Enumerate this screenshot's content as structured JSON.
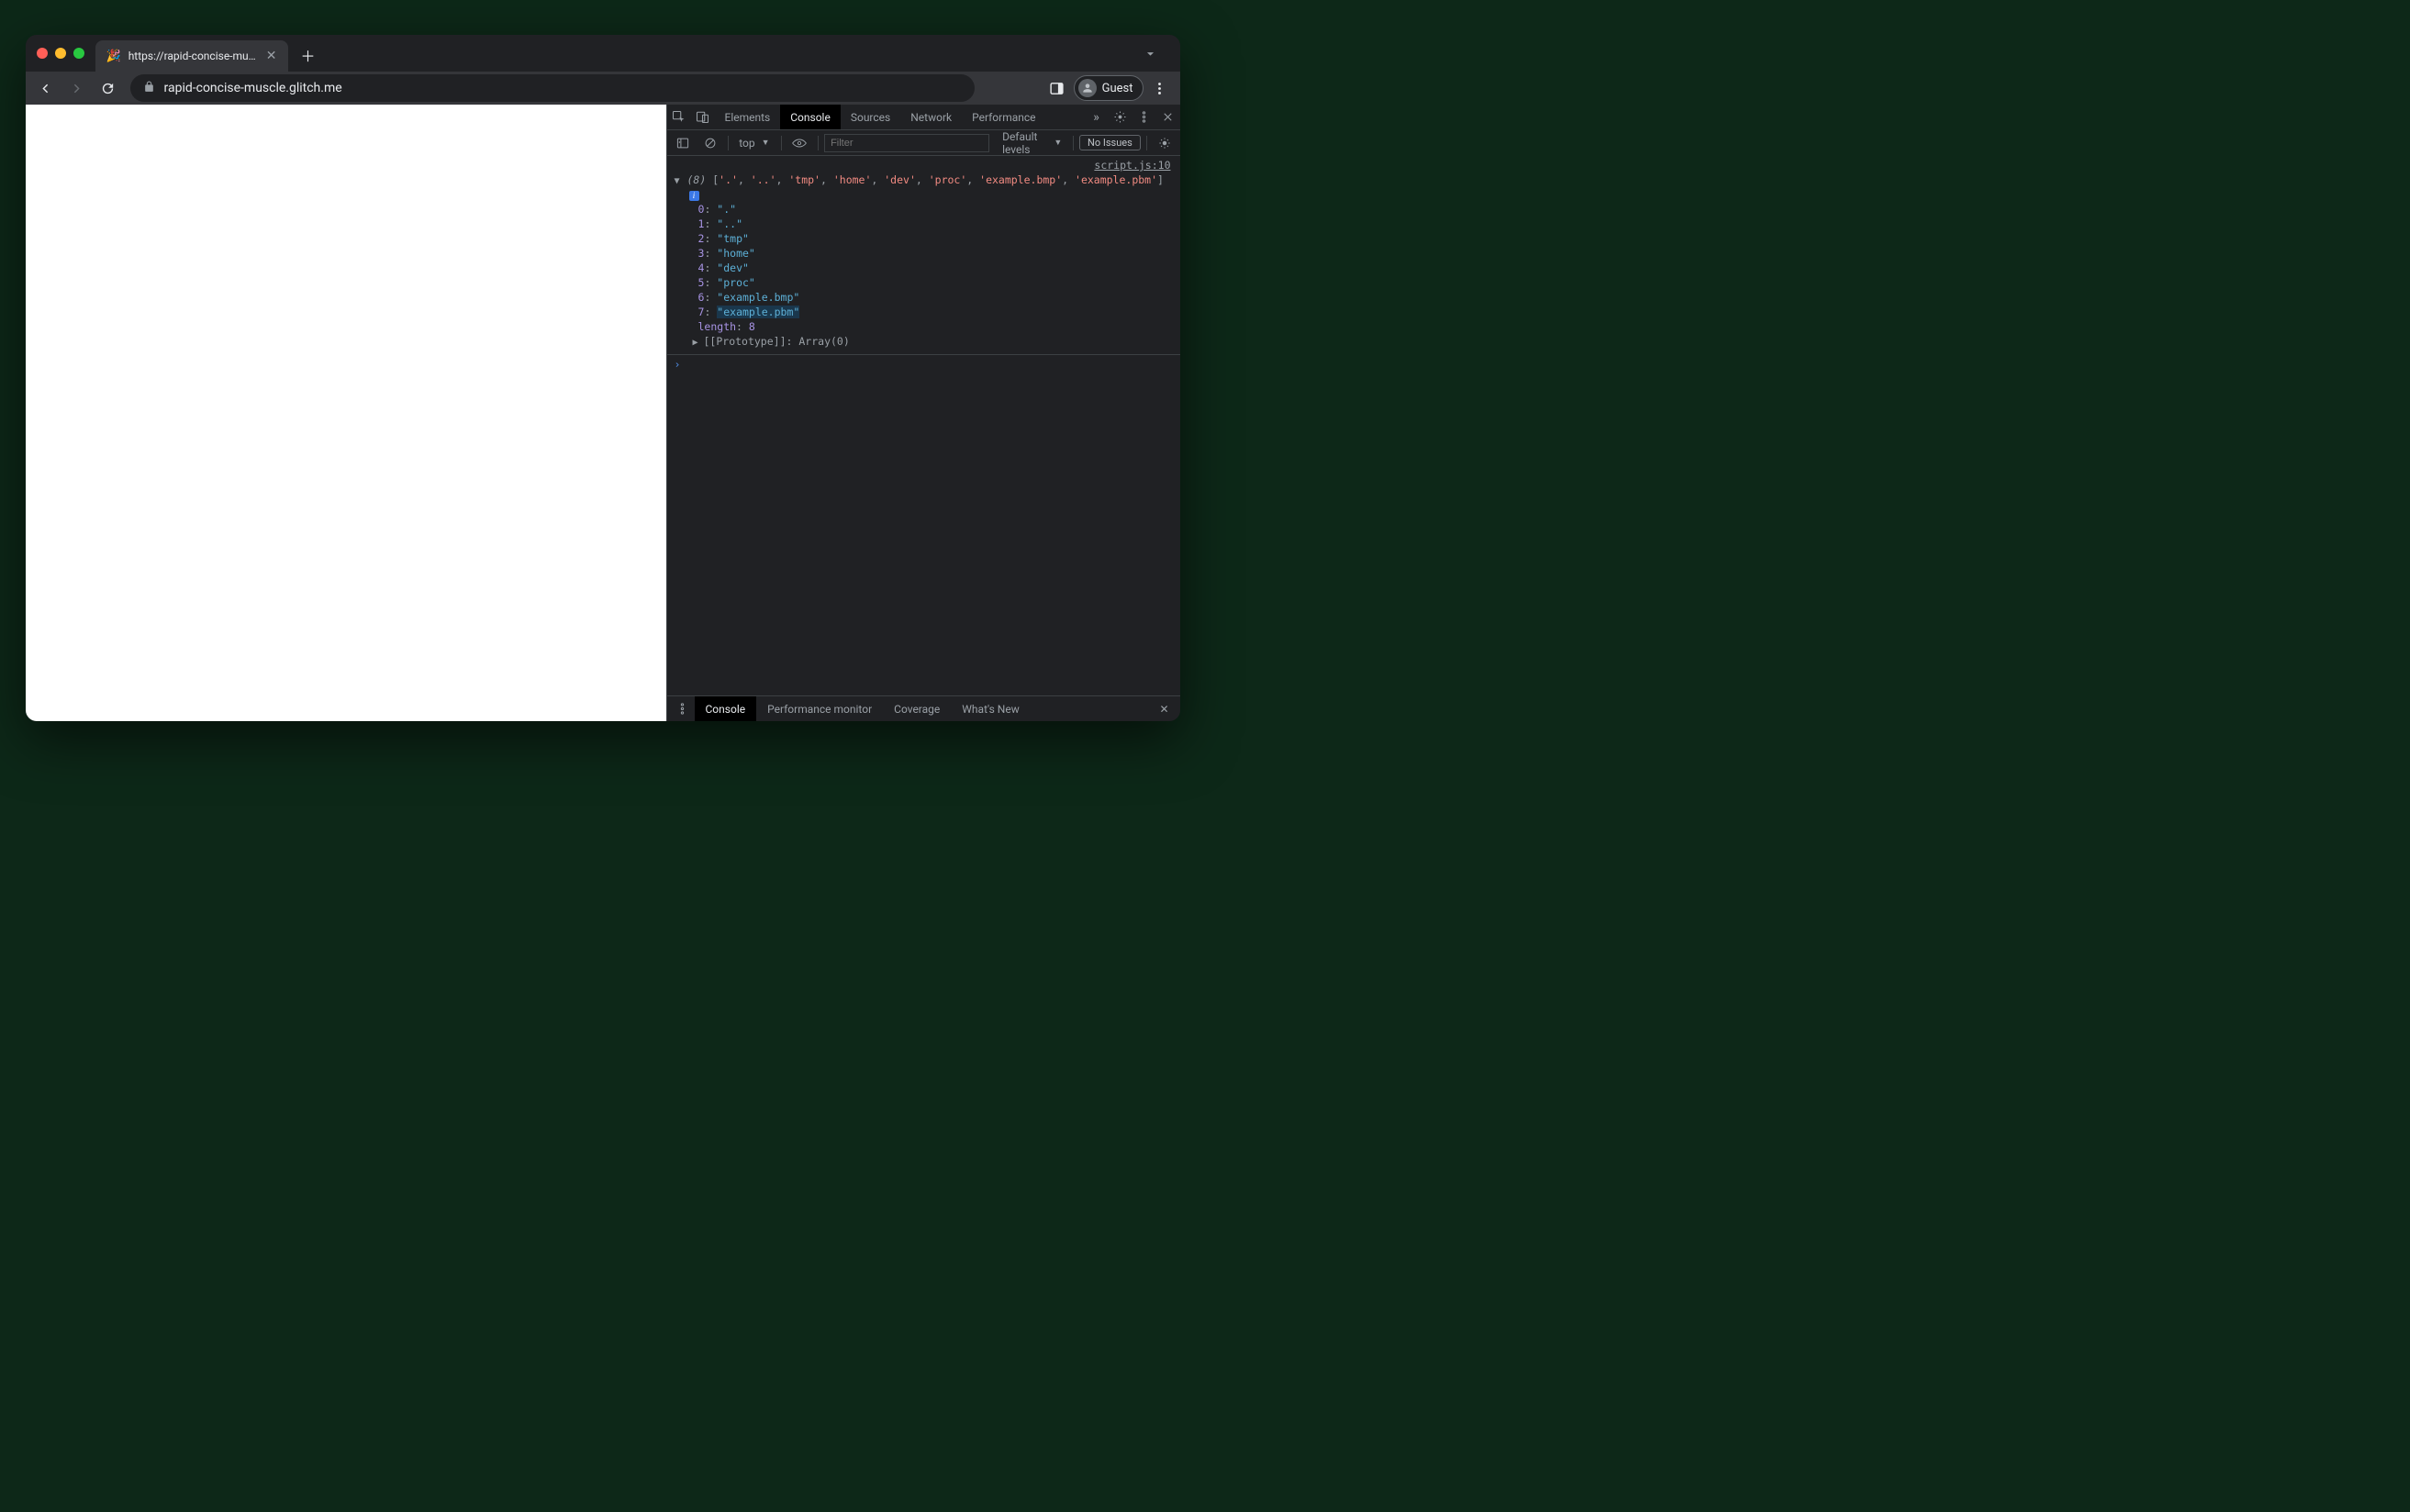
{
  "browser": {
    "tab_title": "https://rapid-concise-muscle.g",
    "tab_favicon": "🎉",
    "url_display": "rapid-concise-muscle.glitch.me",
    "guest_label": "Guest"
  },
  "devtools": {
    "tabs": [
      "Elements",
      "Console",
      "Sources",
      "Network",
      "Performance"
    ],
    "active_tab": "Console",
    "toolbar": {
      "context": "top",
      "filter_placeholder": "Filter",
      "levels": "Default levels",
      "issues": "No Issues"
    },
    "source_link": "script.js:10",
    "array_summary": {
      "length_display": "(8)",
      "items": [
        ".",
        "..",
        "tmp",
        "home",
        "dev",
        "proc",
        "example.bmp",
        "example.pbm"
      ]
    },
    "expanded": [
      {
        "i": "0",
        "v": "\".\""
      },
      {
        "i": "1",
        "v": "\"..\""
      },
      {
        "i": "2",
        "v": "\"tmp\""
      },
      {
        "i": "3",
        "v": "\"home\""
      },
      {
        "i": "4",
        "v": "\"dev\""
      },
      {
        "i": "5",
        "v": "\"proc\""
      },
      {
        "i": "6",
        "v": "\"example.bmp\""
      },
      {
        "i": "7",
        "v": "\"example.pbm\""
      }
    ],
    "length_label": "length",
    "length_value": "8",
    "prototype_label": "[[Prototype]]",
    "prototype_value": "Array(0)",
    "drawer_tabs": [
      "Console",
      "Performance monitor",
      "Coverage",
      "What's New"
    ],
    "drawer_active": "Console"
  }
}
